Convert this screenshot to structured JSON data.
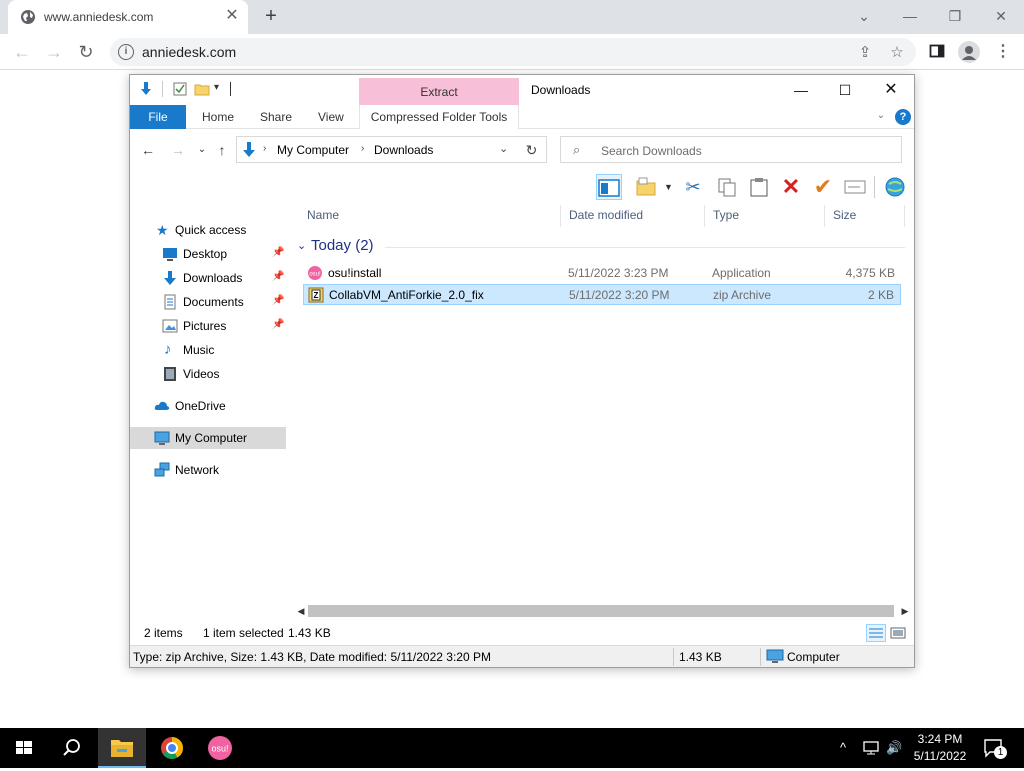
{
  "browser": {
    "tab_title": "www.anniedesk.com",
    "url": "anniedesk.com"
  },
  "explorer": {
    "context_tab": "Extract",
    "window_title": "Downloads",
    "ribbon_tabs": {
      "file": "File",
      "home": "Home",
      "share": "Share",
      "view": "View",
      "compressed": "Compressed Folder Tools"
    },
    "breadcrumb": [
      "My Computer",
      "Downloads"
    ],
    "search_placeholder": "Search Downloads",
    "nav": {
      "quick_access": "Quick access",
      "desktop": "Desktop",
      "downloads": "Downloads",
      "documents": "Documents",
      "pictures": "Pictures",
      "music": "Music",
      "videos": "Videos",
      "onedrive": "OneDrive",
      "my_computer": "My Computer",
      "network": "Network"
    },
    "columns": {
      "name": "Name",
      "date": "Date modified",
      "type": "Type",
      "size": "Size"
    },
    "group_label": "Today (2)",
    "files": [
      {
        "name": "osu!install",
        "date": "5/11/2022 3:23 PM",
        "type": "Application",
        "size": "4,375 KB",
        "icon": "osu-icon"
      },
      {
        "name": "CollabVM_AntiForkie_2.0_fix",
        "date": "5/11/2022 3:20 PM",
        "type": "zip Archive",
        "size": "2 KB",
        "icon": "zip-icon"
      }
    ],
    "status": {
      "items": "2 items",
      "selected": "1 item selected",
      "selected_size": "1.43 KB"
    },
    "details": {
      "info": "Type: zip Archive, Size: 1.43 KB, Date modified: 5/11/2022 3:20 PM",
      "size": "1.43 KB",
      "location": "Computer"
    }
  },
  "taskbar": {
    "time": "3:24 PM",
    "date": "5/11/2022",
    "notification_count": "1"
  },
  "colors": {
    "accent": "#1979ca",
    "selection": "#cce8ff",
    "context_tab": "#f8c0d8"
  }
}
